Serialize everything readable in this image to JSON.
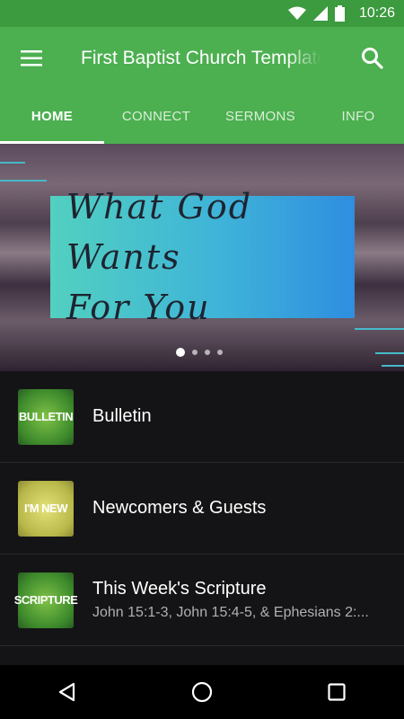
{
  "status_bar": {
    "time": "10:26",
    "icons": [
      "wifi-icon",
      "signal-icon",
      "battery-icon"
    ]
  },
  "toolbar": {
    "title": "First Baptist Church Template",
    "menu_icon": "hamburger-icon",
    "search_icon": "search-icon"
  },
  "tabs": [
    {
      "label": "HOME",
      "active": true
    },
    {
      "label": "CONNECT",
      "active": false
    },
    {
      "label": "SERMONS",
      "active": false
    },
    {
      "label": "INFO",
      "active": false
    }
  ],
  "banner": {
    "line1": "What God Wants",
    "line2": "For You",
    "page_count": 4,
    "active_page": 1
  },
  "list": [
    {
      "thumb_text": "BULLETIN",
      "title": "Bulletin",
      "subtitle": ""
    },
    {
      "thumb_text": "I'M NEW",
      "title": "Newcomers & Guests",
      "subtitle": ""
    },
    {
      "thumb_text": "SCRIPTURE",
      "title": "This Week's Scripture",
      "subtitle": "John 15:1-3, John 15:4-5, & Ephesians 2:..."
    }
  ],
  "nav_bar": {
    "icons": [
      "back-icon",
      "home-icon",
      "recents-icon"
    ]
  },
  "colors": {
    "primary": "#4caf50",
    "status_bar": "#3c9a3f",
    "background": "#141416",
    "accent_cyan": "#46b9c9"
  }
}
